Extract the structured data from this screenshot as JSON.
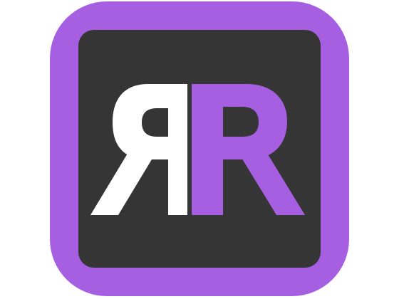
{
  "logo": {
    "name": "RR",
    "letter_left": "R",
    "letter_right": "R",
    "colors": {
      "frame": "#a65fe1",
      "background": "#363536",
      "letter_left": "#ffffff",
      "letter_right": "#a65fe1",
      "page": "#ffffff"
    }
  }
}
